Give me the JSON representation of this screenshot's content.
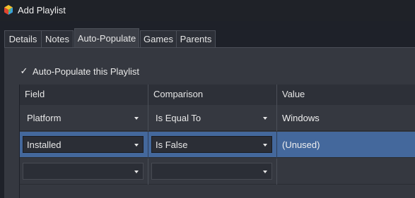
{
  "window": {
    "title": "Add Playlist",
    "icon": "launchbox-logo-icon"
  },
  "tabs": [
    {
      "label": "Details",
      "active": false
    },
    {
      "label": "Notes",
      "active": false
    },
    {
      "label": "Auto-Populate",
      "active": true
    },
    {
      "label": "Games",
      "active": false
    },
    {
      "label": "Parents",
      "active": false
    }
  ],
  "auto_populate": {
    "checkbox_label": "Auto-Populate this Playlist",
    "checked": true,
    "check_glyph": "✓"
  },
  "grid": {
    "columns": [
      "Field",
      "Comparison",
      "Value"
    ],
    "rows": [
      {
        "field": "Platform",
        "comparison": "Is Equal To",
        "value": "Windows",
        "selected": false
      },
      {
        "field": "Installed",
        "comparison": "Is False",
        "value": "(Unused)",
        "selected": true
      },
      {
        "field": "",
        "comparison": "",
        "value": "",
        "selected": false
      }
    ]
  },
  "colors": {
    "background": "#1e2129",
    "panel": "#353840",
    "selected_row": "#44689c"
  }
}
